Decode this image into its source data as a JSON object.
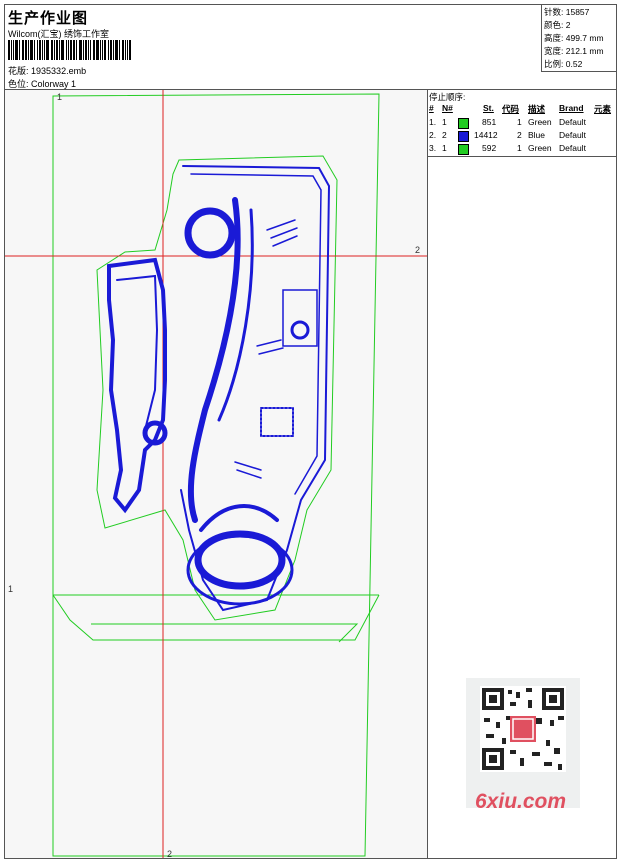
{
  "header": {
    "title": "生产作业图",
    "subtitle": "Wilcom(汇宝) 绣饰工作室",
    "design_label": "花版:",
    "design_value": "1935332.emb",
    "colorway_label": "色位:",
    "colorway_value": "Colorway 1"
  },
  "stats": {
    "stitches_label": "针数:",
    "stitches_value": "15857",
    "colors_label": "颜色:",
    "colors_value": "2",
    "height_label": "高度:",
    "height_value": "499.7 mm",
    "width_label": "宽度:",
    "width_value": "212.1 mm",
    "scale_label": "比例:",
    "scale_value": "0.52"
  },
  "stop_sequence": {
    "title": "停止顺序:",
    "headers": [
      "#",
      "N#",
      "St.",
      "代码",
      "描述",
      "Brand",
      "元素"
    ],
    "rows": [
      {
        "index": "1.",
        "needle": "1",
        "color": "#22cc22",
        "stitches": "851",
        "code": "1",
        "desc": "Green",
        "brand": "Default"
      },
      {
        "index": "2.",
        "needle": "2",
        "color": "#1a1ad6",
        "stitches": "14412",
        "code": "2",
        "desc": "Blue",
        "brand": "Default"
      },
      {
        "index": "3.",
        "needle": "1",
        "color": "#22cc22",
        "stitches": "592",
        "code": "1",
        "desc": "Green",
        "brand": "Default"
      }
    ]
  },
  "canvas": {
    "marker_1_top": "1",
    "marker_2_right": "2",
    "marker_1_left": "1",
    "marker_2_bottom": "2",
    "outline_color": "#22cc22",
    "stitch_color": "#1a1ad6",
    "guide_color": "#dd2222"
  },
  "watermark": {
    "text": "6xiu.com"
  }
}
